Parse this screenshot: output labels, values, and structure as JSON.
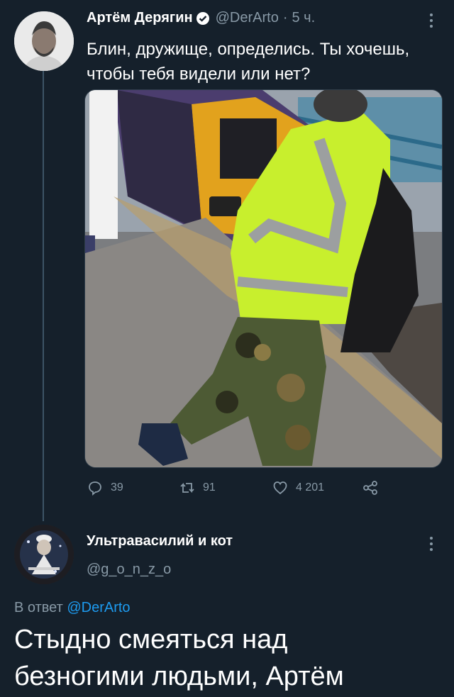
{
  "tweet": {
    "author_name": "Артём Дерягин",
    "handle": "@DerArto",
    "separator": "·",
    "time": "5 ч.",
    "text": "Блин, дружище, определись. Ты хочешь, чтобы тебя видели или нет?",
    "actions": {
      "replies": "39",
      "retweets": "91",
      "likes": "4 201"
    },
    "icons": [
      "verified-badge-icon",
      "more-icon",
      "reply-icon",
      "retweet-icon",
      "like-icon",
      "share-icon"
    ]
  },
  "reply": {
    "author_name": "Ультравасилий и кот",
    "handle": "@g_o_n_z_o",
    "reply_prefix": "В ответ",
    "reply_to": "@DerArto",
    "text": "Стыдно смеяться над безногими людьми, Артём"
  },
  "colors": {
    "background": "#15202b",
    "muted": "#8899a6",
    "link": "#1d9bf0",
    "thread_line": "#3d5466"
  }
}
